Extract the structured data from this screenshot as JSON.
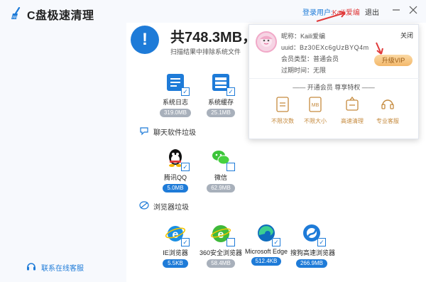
{
  "app": {
    "title": "C盘极速清理"
  },
  "header": {
    "login_label": "登录用户:",
    "username": "Kaili爱编",
    "logout": "退出"
  },
  "summary": {
    "total": "共748.3MB，",
    "subtitle": "扫描结果中排除系统文件"
  },
  "system_items": [
    {
      "name": "系统日志",
      "size": "319.0MB",
      "checked": true,
      "badge": "grey"
    },
    {
      "name": "系统缓存",
      "size": "25.1MB",
      "checked": true,
      "badge": "grey"
    }
  ],
  "chat_section": {
    "label": "聊天软件垃圾"
  },
  "chat_items": [
    {
      "name": "腾讯QQ",
      "size": "5.0MB",
      "checked": true,
      "badge": "blue"
    },
    {
      "name": "微信",
      "size": "62.9MB",
      "checked": false,
      "badge": "grey"
    }
  ],
  "browser_section": {
    "label": "浏览器垃圾"
  },
  "browser_items": [
    {
      "name": "IE浏览器",
      "size": "5.5KB",
      "checked": true,
      "badge": "blue"
    },
    {
      "name": "360安全浏览器",
      "size": "58.4MB",
      "checked": false,
      "badge": "grey"
    },
    {
      "name": "Microsoft Edge",
      "size": "512.4KB",
      "checked": true,
      "badge": "blue"
    },
    {
      "name": "搜狗高速浏览器",
      "size": "266.9MB",
      "checked": true,
      "badge": "blue"
    }
  ],
  "support": {
    "label": "联系在线客服"
  },
  "popup": {
    "close": "关闭",
    "nickname_label": "昵称：",
    "nickname": "Kaili爱编",
    "uuid_label": "uuid：",
    "uuid": "Bz30EXc6gUzBYQ4m",
    "member_label": "会员类型：",
    "member": "普通会员",
    "expire_label": "过期时间：",
    "expire": "无限",
    "upgrade": "升级VIP",
    "privileges_title": "—— 开通会员  尊享特权 ——",
    "privileges": [
      {
        "label": "不限次数",
        "icon": "unlimited-count-icon"
      },
      {
        "label": "不限大小",
        "icon": "unlimited-size-icon"
      },
      {
        "label": "高速清理",
        "icon": "fast-clean-icon"
      },
      {
        "label": "专业客服",
        "icon": "pro-support-icon"
      }
    ]
  },
  "colors": {
    "accent": "#1e7bd8",
    "highlight": "#e03a3a",
    "vip": "#f3b86b",
    "privilege": "#c58a3d"
  }
}
